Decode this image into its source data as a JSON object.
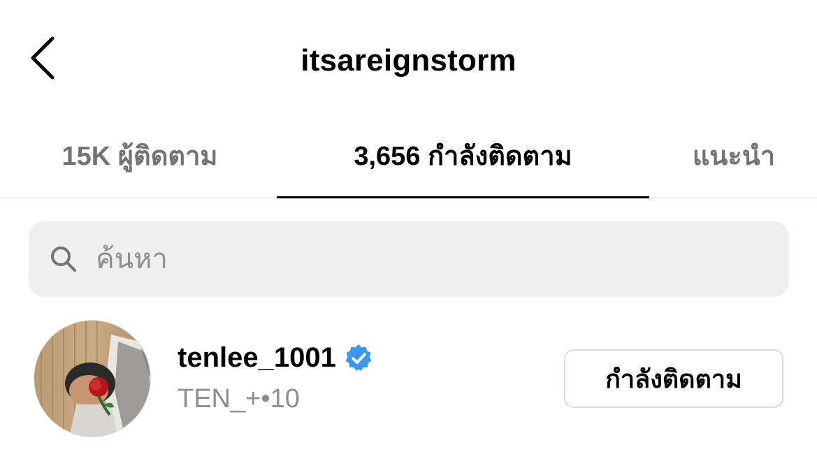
{
  "header": {
    "title": "itsareignstorm",
    "back_icon": "chevron-left-icon"
  },
  "tabs": [
    {
      "label": "15K ผู้ติดตาม",
      "active": false
    },
    {
      "label": "3,656 กำลังติดตาม",
      "active": true
    },
    {
      "label": "แนะนำ",
      "active": false
    }
  ],
  "search": {
    "placeholder": "ค้นหา",
    "value": "",
    "icon": "search-icon"
  },
  "list": [
    {
      "username": "tenlee_1001",
      "verified": true,
      "fullname": "TEN_+•10",
      "button_label": "กำลังติดตาม",
      "avatar_icon": "avatar-photo"
    }
  ],
  "colors": {
    "text_primary": "#000000",
    "text_secondary": "#737373",
    "search_bg": "#efefef",
    "verified_blue": "#3897f0",
    "divider": "#dbdbdb"
  }
}
